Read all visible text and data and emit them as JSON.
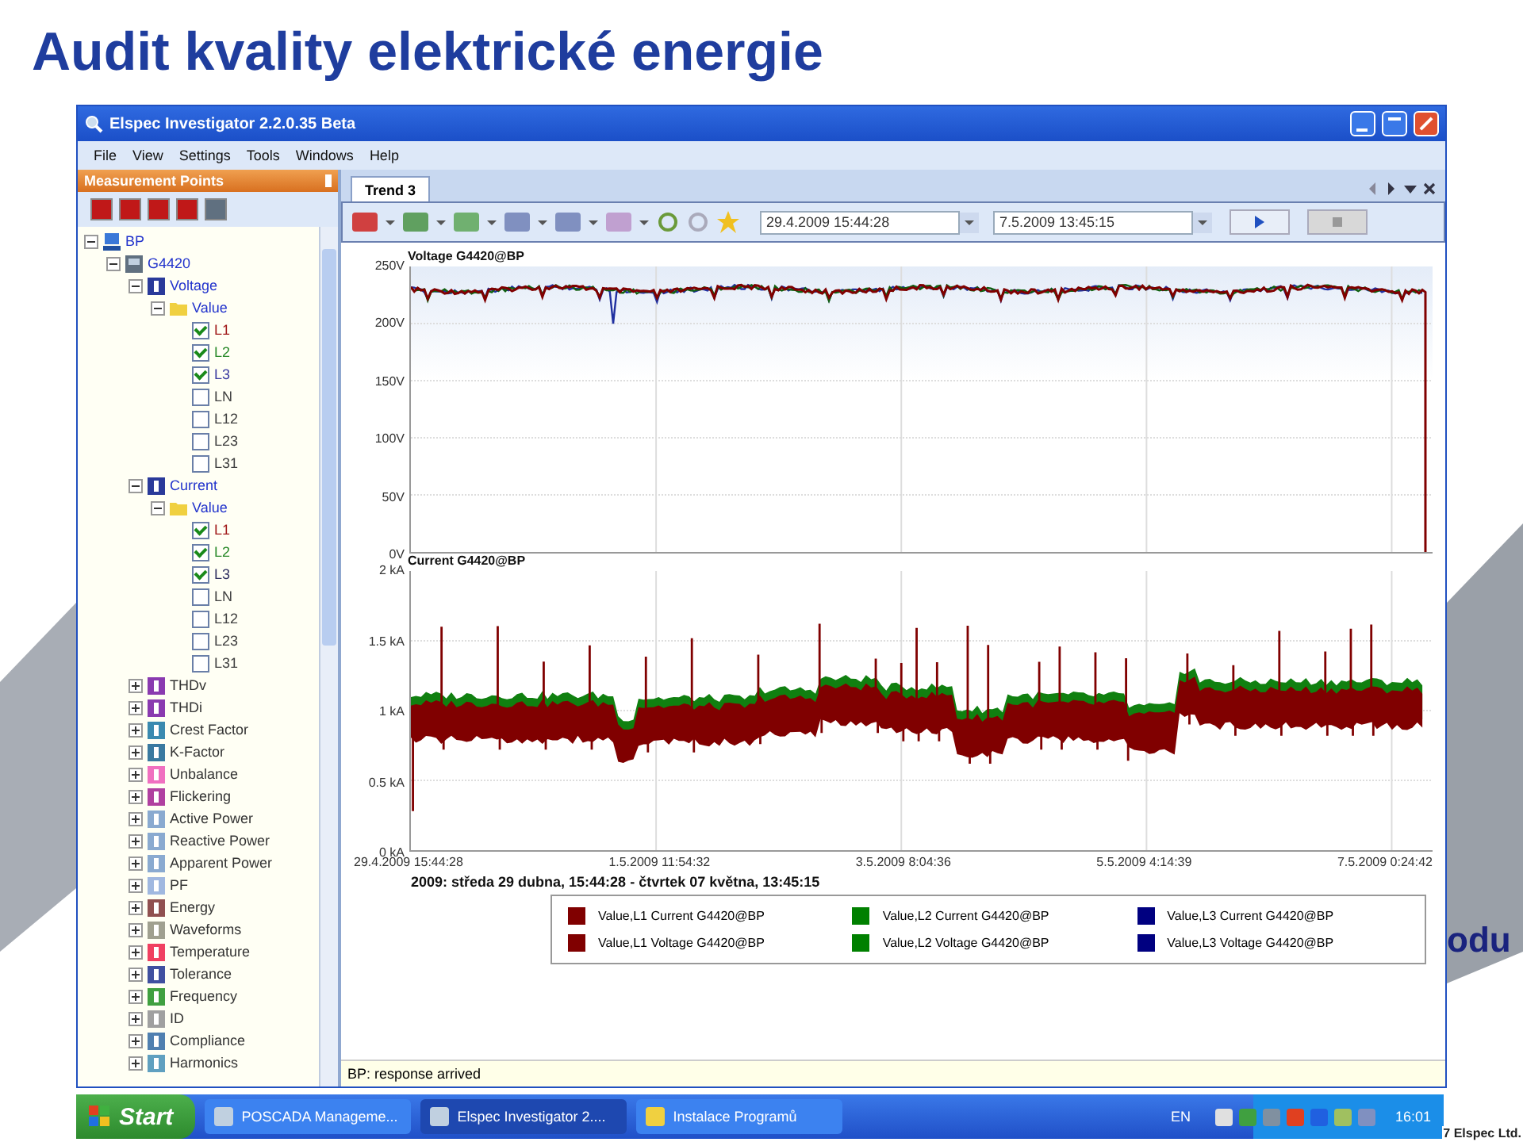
{
  "slide": {
    "title": "Audit kvality elektrické energie",
    "partial_text": "odu",
    "footer": "7 Elspec Ltd."
  },
  "window": {
    "title": "Elspec Investigator 2.2.0.35 Beta"
  },
  "menu": [
    "File",
    "View",
    "Settings",
    "Tools",
    "Windows",
    "Help"
  ],
  "panel": {
    "title": "Measurement Points"
  },
  "tree": [
    {
      "label": "BP",
      "kind": "site",
      "expanded": true,
      "children": [
        {
          "label": "G4420",
          "kind": "device",
          "expanded": true,
          "children": [
            {
              "label": "Voltage",
              "kind": "group",
              "color": "#2a3a9a",
              "expanded": true,
              "children": [
                {
                  "label": "Value",
                  "kind": "folder",
                  "expanded": true,
                  "children": [
                    {
                      "label": "L1",
                      "kind": "channel",
                      "checked": true,
                      "color": "#a01818"
                    },
                    {
                      "label": "L2",
                      "kind": "channel",
                      "checked": true,
                      "color": "#2a8a2a"
                    },
                    {
                      "label": "L3",
                      "kind": "channel",
                      "checked": true,
                      "color": "#3a3aa0"
                    },
                    {
                      "label": "LN",
                      "kind": "channel",
                      "checked": false,
                      "color": "#404040"
                    },
                    {
                      "label": "L12",
                      "kind": "channel",
                      "checked": false,
                      "color": "#404040"
                    },
                    {
                      "label": "L23",
                      "kind": "channel",
                      "checked": false,
                      "color": "#404040"
                    },
                    {
                      "label": "L31",
                      "kind": "channel",
                      "checked": false,
                      "color": "#404040"
                    }
                  ]
                }
              ]
            },
            {
              "label": "Current",
              "kind": "group",
              "color": "#2a3a9a",
              "expanded": true,
              "children": [
                {
                  "label": "Value",
                  "kind": "folder",
                  "expanded": true,
                  "children": [
                    {
                      "label": "L1",
                      "kind": "channel",
                      "checked": true,
                      "color": "#a01818"
                    },
                    {
                      "label": "L2",
                      "kind": "channel",
                      "checked": true,
                      "color": "#2a8a2a"
                    },
                    {
                      "label": "L3",
                      "kind": "channel",
                      "checked": true,
                      "color": "#303060"
                    },
                    {
                      "label": "LN",
                      "kind": "channel",
                      "checked": false,
                      "color": "#404040"
                    },
                    {
                      "label": "L12",
                      "kind": "channel",
                      "checked": false,
                      "color": "#404040"
                    },
                    {
                      "label": "L23",
                      "kind": "channel",
                      "checked": false,
                      "color": "#404040"
                    },
                    {
                      "label": "L31",
                      "kind": "channel",
                      "checked": false,
                      "color": "#404040"
                    }
                  ]
                }
              ]
            },
            {
              "label": "THDv",
              "kind": "group",
              "color": "#8a3ab0",
              "expanded": false
            },
            {
              "label": "THDi",
              "kind": "group",
              "color": "#8a3ab0",
              "expanded": false
            },
            {
              "label": "Crest Factor",
              "kind": "group",
              "color": "#3a8ab0",
              "expanded": false
            },
            {
              "label": "K-Factor",
              "kind": "group",
              "color": "#3a7aa0",
              "expanded": false
            },
            {
              "label": "Unbalance",
              "kind": "group",
              "color": "#f070c0",
              "expanded": false
            },
            {
              "label": "Flickering",
              "kind": "group",
              "color": "#b040a0",
              "expanded": false
            },
            {
              "label": "Active Power",
              "kind": "group",
              "color": "#8aaad0",
              "expanded": false
            },
            {
              "label": "Reactive Power",
              "kind": "group",
              "color": "#8aaad0",
              "expanded": false
            },
            {
              "label": "Apparent Power",
              "kind": "group",
              "color": "#8aaad0",
              "expanded": false
            },
            {
              "label": "PF",
              "kind": "group",
              "color": "#a0b8e0",
              "expanded": false
            },
            {
              "label": "Energy",
              "kind": "group",
              "color": "#905050",
              "expanded": false
            },
            {
              "label": "Waveforms",
              "kind": "group",
              "color": "#a0a090",
              "expanded": false
            },
            {
              "label": "Temperature",
              "kind": "group",
              "color": "#f04060",
              "expanded": false
            },
            {
              "label": "Tolerance",
              "kind": "group",
              "color": "#4050a0",
              "expanded": false
            },
            {
              "label": "Frequency",
              "kind": "group",
              "color": "#40a040",
              "expanded": false
            },
            {
              "label": "ID",
              "kind": "group",
              "color": "#a0a0a0",
              "expanded": false
            },
            {
              "label": "Compliance",
              "kind": "group",
              "color": "#5080b0",
              "expanded": false
            },
            {
              "label": "Harmonics",
              "kind": "group",
              "color": "#60a0c0",
              "expanded": false
            }
          ]
        }
      ]
    }
  ],
  "tabs": [
    {
      "label": "Trend 3",
      "selected": true
    }
  ],
  "toolbar": {
    "start": "29.4.2009 15:44:28",
    "end": "7.5.2009 13:45:15"
  },
  "charts": [
    {
      "title": "Voltage G4420@BP",
      "kind": "voltage",
      "y_labels": [
        "250V",
        "200V",
        "150V",
        "100V",
        "50V",
        "0V"
      ]
    },
    {
      "title": "Current G4420@BP",
      "kind": "current",
      "y_labels": [
        "2 kA",
        "1.5 kA",
        "1 kA",
        "0.5 kA",
        "0 kA"
      ]
    }
  ],
  "x_labels": [
    "29.4.2009 15:44:28",
    "1.5.2009 11:54:32",
    "3.5.2009 8:04:36",
    "5.5.2009 4:14:39",
    "7.5.2009 0:24:42"
  ],
  "range": "2009: středa 29 dubna, 15:44:28 - čtvrtek 07 května, 13:45:15",
  "legend": [
    {
      "label": "Value,L1 Current G4420@BP",
      "color": "#800000"
    },
    {
      "label": "Value,L2 Current G4420@BP",
      "color": "#008000"
    },
    {
      "label": "Value,L3 Current G4420@BP",
      "color": "#000080"
    },
    {
      "label": "Value,L1 Voltage G4420@BP",
      "color": "#800000"
    },
    {
      "label": "Value,L2 Voltage G4420@BP",
      "color": "#008000"
    },
    {
      "label": "Value,L3 Voltage G4420@BP",
      "color": "#000080"
    }
  ],
  "status_bar": "BP: response arrived",
  "taskbar": {
    "start": "Start",
    "tasks": [
      {
        "label": "POSCADA Manageme...",
        "selected": false
      },
      {
        "label": "Elspec Investigator 2....",
        "selected": true
      },
      {
        "label": "Instalace Programů",
        "selected": false
      }
    ],
    "language": "EN",
    "clock": "16:01"
  }
}
